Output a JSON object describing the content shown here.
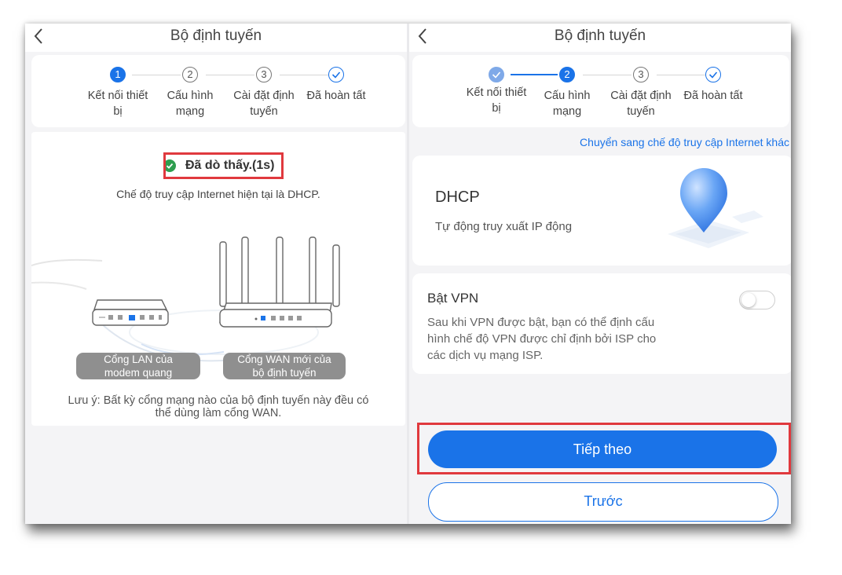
{
  "left": {
    "title": "Bộ định tuyến",
    "steps": [
      {
        "num": "1",
        "label_l1": "Kết nối thiết",
        "label_l2": "bị"
      },
      {
        "num": "2",
        "label_l1": "Cấu hình",
        "label_l2": "mạng"
      },
      {
        "num": "3",
        "label_l1": "Cài đặt định",
        "label_l2": "tuyến"
      },
      {
        "num": "",
        "label_l1": "Đã hoàn tất",
        "label_l2": ""
      }
    ],
    "detected": "Đã dò thấy.(1s)",
    "mode_text": "Chế độ truy cập Internet hiện tại là DHCP.",
    "lan_label_l1": "Cổng LAN của",
    "lan_label_l2": "modem quang",
    "wan_label_l1": "Cổng WAN mới của",
    "wan_label_l2": "bộ định tuyến",
    "note_l1": "Lưu ý: Bất kỳ cổng mạng nào của bộ định tuyến này đều có",
    "note_l2": "thể dùng làm cổng WAN."
  },
  "right": {
    "title": "Bộ định tuyến",
    "steps": [
      {
        "num": "",
        "label_l1": "Kết nối thiết",
        "label_l2": "bị"
      },
      {
        "num": "2",
        "label_l1": "Cấu hình",
        "label_l2": "mạng"
      },
      {
        "num": "3",
        "label_l1": "Cài đặt định",
        "label_l2": "tuyến"
      },
      {
        "num": "",
        "label_l1": "Đã hoàn tất",
        "label_l2": ""
      }
    ],
    "switch_link": "Chuyển sang chế độ truy cập Internet khác",
    "dhcp_title": "DHCP",
    "dhcp_desc": "Tự động truy xuất IP động",
    "vpn_title": "Bật VPN",
    "vpn_desc_l1": "Sau khi VPN được bật, bạn có thể định cấu",
    "vpn_desc_l2": "hình chế độ VPN được chỉ định bởi ISP cho",
    "vpn_desc_l3": "các dịch vụ mạng ISP.",
    "vpn_enabled": false,
    "next_label": "Tiếp theo",
    "prev_label": "Trước"
  },
  "colors": {
    "accent": "#1a73e8",
    "highlight": "#e0393e",
    "success": "#2e9e4f"
  }
}
